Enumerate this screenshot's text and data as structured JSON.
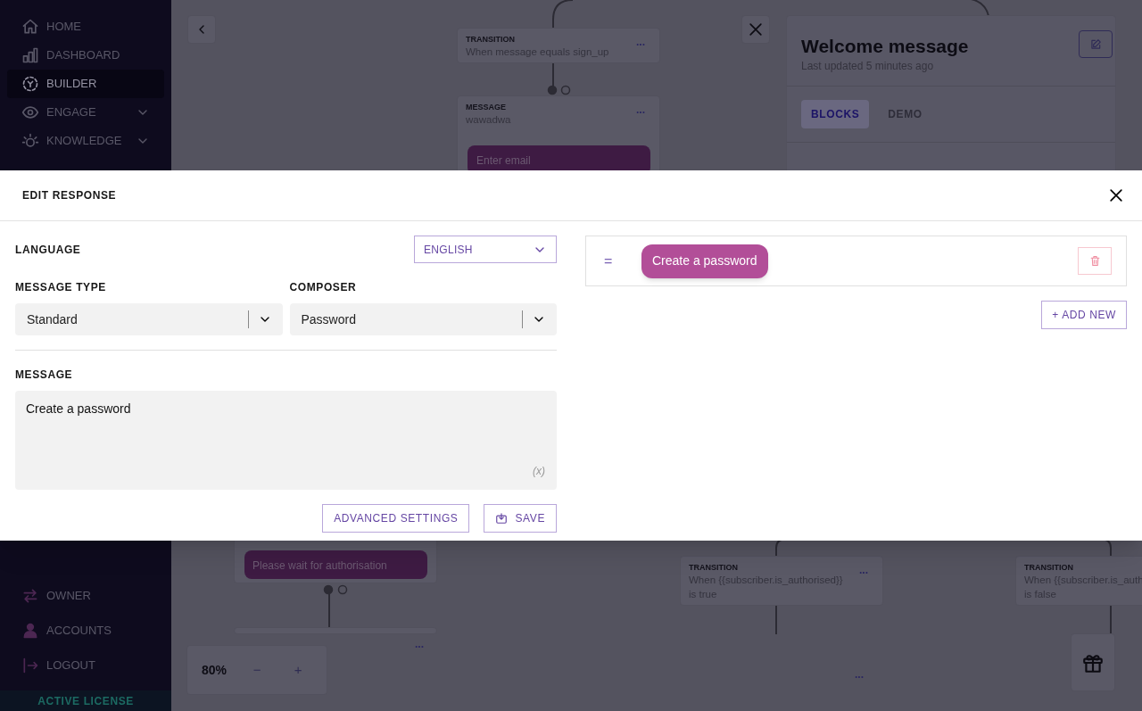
{
  "sidebar": {
    "items": [
      {
        "label": "HOME",
        "selected": false,
        "expandable": false
      },
      {
        "label": "DASHBOARD",
        "selected": false,
        "expandable": false
      },
      {
        "label": "BUILDER",
        "selected": true,
        "expandable": false
      },
      {
        "label": "ENGAGE",
        "selected": false,
        "expandable": true
      },
      {
        "label": "KNOWLEDGE",
        "selected": false,
        "expandable": true
      }
    ],
    "bottom_items": [
      {
        "label": "OWNER"
      },
      {
        "label": "ACCOUNTS"
      },
      {
        "label": "LOGOUT"
      }
    ],
    "license": "ACTIVE LICENSE"
  },
  "canvas": {
    "nodes": [
      {
        "kind": "transition",
        "title": "TRANSITION",
        "lines": [
          "When message equals sign_up"
        ],
        "menu": "..."
      },
      {
        "kind": "message",
        "title": "MESSAGE",
        "lines": [
          "wawadwa"
        ],
        "bubble": "Enter email",
        "menu": "..."
      },
      {
        "kind": "bubble",
        "bubble": "Please wait for authorisation"
      },
      {
        "kind": "stub",
        "menu": "..."
      },
      {
        "kind": "transition",
        "title": "TRANSITION",
        "lines": [
          "When {{subscriber.is_authorised}}",
          "is true"
        ],
        "menu": "..."
      },
      {
        "kind": "transition",
        "title": "TRANSITION",
        "lines": [
          "When {{subscriber.is_auth",
          "is false"
        ]
      },
      {
        "kind": "more",
        "menu": "..."
      }
    ],
    "zoom": {
      "value": "80%",
      "minus": "−",
      "plus": "+"
    }
  },
  "panel": {
    "title": "Welcome message",
    "subtitle": "Last updated 5 minutes ago",
    "tabs": [
      {
        "label": "BLOCKS",
        "selected": true
      },
      {
        "label": "DEMO",
        "selected": false
      }
    ]
  },
  "modal": {
    "title": "EDIT RESPONSE",
    "language": {
      "label": "LANGUAGE",
      "value": "ENGLISH"
    },
    "message_type": {
      "label": "MESSAGE TYPE",
      "value": "Standard"
    },
    "composer": {
      "label": "COMPOSER",
      "value": "Password"
    },
    "message": {
      "label": "MESSAGE",
      "value": "Create a password",
      "variable": "(x)"
    },
    "buttons": [
      "ADVANCED SETTINGS",
      "SAVE"
    ],
    "blocks": [
      {
        "text": "Create a password",
        "drag": "="
      }
    ],
    "add_new": "+ ADD NEW"
  }
}
